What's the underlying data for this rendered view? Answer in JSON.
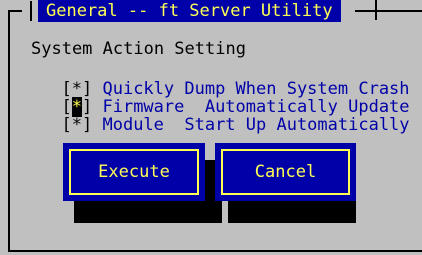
{
  "window": {
    "title": "General -- ft Server Utility"
  },
  "section": {
    "heading": "System Action Setting"
  },
  "options": [
    {
      "mark": "*",
      "label": "Quickly Dump When System Crash"
    },
    {
      "mark": "*",
      "label": "Firmware  Automatically Update"
    },
    {
      "mark": "*",
      "label": "Module  Start Up Automatically"
    }
  ],
  "buttons": {
    "execute": "Execute",
    "cancel": "Cancel"
  },
  "colors": {
    "background": "#c0c0c0",
    "accent": "#0000a8",
    "highlight": "#ffff55"
  }
}
